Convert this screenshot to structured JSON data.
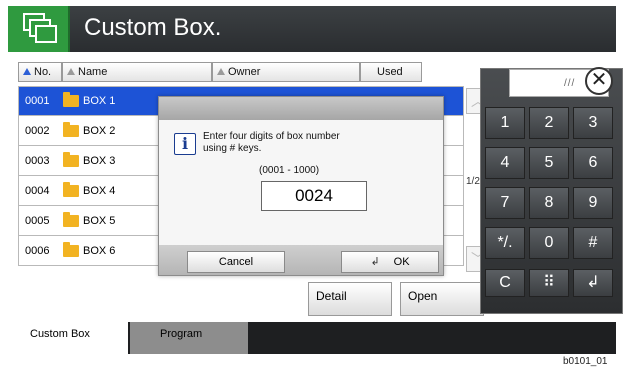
{
  "header": {
    "title": "Custom Box."
  },
  "table": {
    "columns": [
      "No.",
      "Name",
      "Owner",
      "Used"
    ],
    "rows": [
      {
        "no": "0001",
        "name": "BOX 1"
      },
      {
        "no": "0002",
        "name": "BOX 2"
      },
      {
        "no": "0003",
        "name": "BOX 3"
      },
      {
        "no": "0004",
        "name": "BOX 4"
      },
      {
        "no": "0005",
        "name": "BOX 5"
      },
      {
        "no": "0006",
        "name": "BOX 6"
      }
    ],
    "page_indicator": "1/2"
  },
  "buttons": {
    "detail": "Detail",
    "open": "Open"
  },
  "dialog": {
    "message_line1": "Enter four digits of box number",
    "message_line2": "using # keys.",
    "range": "(0001 - 1000)",
    "value": "0024",
    "cancel": "Cancel",
    "ok": "OK",
    "ok_enter_glyph": "↲"
  },
  "keypad": {
    "grip": "///",
    "close": "✕",
    "keys": [
      "1",
      "2",
      "3",
      "4",
      "5",
      "6",
      "7",
      "8",
      "9",
      "*/.",
      "0",
      "#",
      "C",
      "⠿",
      "↲"
    ]
  },
  "tabs": {
    "custom_box": "Custom Box",
    "program": "Program"
  },
  "caption": "b0101_01",
  "colors": {
    "accent_green": "#2f9a3f",
    "selection_blue": "#1d53d6",
    "header_dark": "#2a2d30"
  }
}
